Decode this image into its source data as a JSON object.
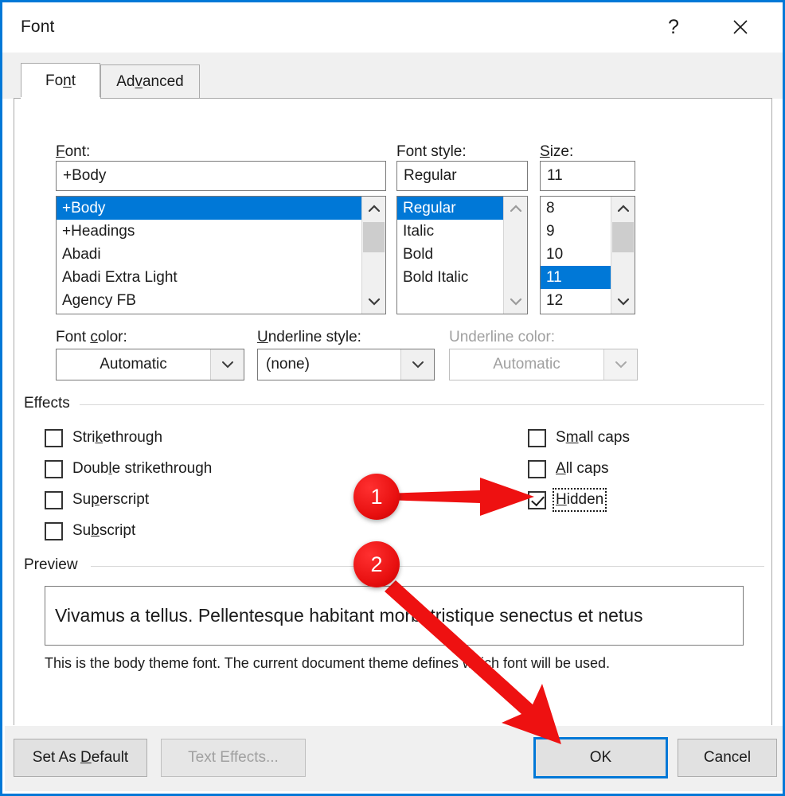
{
  "window": {
    "title": "Font",
    "help_label": "?",
    "close_label": "✕"
  },
  "tabs": [
    {
      "label": "Font",
      "accel": "n",
      "selected": true
    },
    {
      "label": "Advanced",
      "accel": "v",
      "selected": false
    }
  ],
  "font_section": {
    "font": {
      "label": "Font:",
      "accel": "F",
      "value": "+Body",
      "items": [
        "+Body",
        "+Headings",
        "Abadi",
        "Abadi Extra Light",
        "Agency FB"
      ],
      "selected_index": 0
    },
    "font_style": {
      "label": "Font style:",
      "value": "Regular",
      "items": [
        "Regular",
        "Italic",
        "Bold",
        "Bold Italic"
      ],
      "selected_index": 0
    },
    "size": {
      "label": "Size:",
      "accel": "S",
      "value": "11",
      "items": [
        "8",
        "9",
        "10",
        "11",
        "12"
      ],
      "selected_index": 3
    }
  },
  "color_row": {
    "font_color": {
      "label": "Font color:",
      "accel": "c",
      "value": "Automatic",
      "disabled": false
    },
    "underline_style": {
      "label": "Underline style:",
      "accel": "U",
      "value": "(none)",
      "disabled": false
    },
    "underline_color": {
      "label": "Underline color:",
      "value": "Automatic",
      "disabled": true
    }
  },
  "effects": {
    "group_label": "Effects",
    "left": [
      {
        "label": "Strikethrough",
        "accel": "k",
        "checked": false
      },
      {
        "label": "Double strikethrough",
        "accel": "l",
        "checked": false
      },
      {
        "label": "Superscript",
        "accel": "p",
        "checked": false
      },
      {
        "label": "Subscript",
        "accel": "b",
        "checked": false
      }
    ],
    "right": [
      {
        "label": "Small caps",
        "accel": "m",
        "checked": false,
        "focused": false
      },
      {
        "label": "All caps",
        "accel": "A",
        "checked": false,
        "focused": false
      },
      {
        "label": "Hidden",
        "accel": "H",
        "checked": true,
        "focused": true
      }
    ]
  },
  "preview": {
    "group_label": "Preview",
    "sample_text": "Vivamus a tellus. Pellentesque habitant morbi tristique senectus et netus",
    "description": "This is the body theme font. The current document theme defines which font will be used."
  },
  "footer": {
    "set_as_default": {
      "label": "Set As Default",
      "accel": "D",
      "disabled": false
    },
    "text_effects": {
      "label": "Text Effects...",
      "disabled": true
    },
    "ok": {
      "label": "OK",
      "default": true
    },
    "cancel": {
      "label": "Cancel"
    }
  },
  "annotations": {
    "accent_color": "#e81010",
    "steps": [
      {
        "number": "1",
        "target": "hidden-checkbox"
      },
      {
        "number": "2",
        "target": "ok-button"
      }
    ]
  },
  "colors": {
    "accent": "#0078d7",
    "selection": "#0078d7",
    "dialog_bg": "#ffffff",
    "chrome_bg": "#f0f0f0",
    "disabled_text": "#a0a0a0"
  }
}
